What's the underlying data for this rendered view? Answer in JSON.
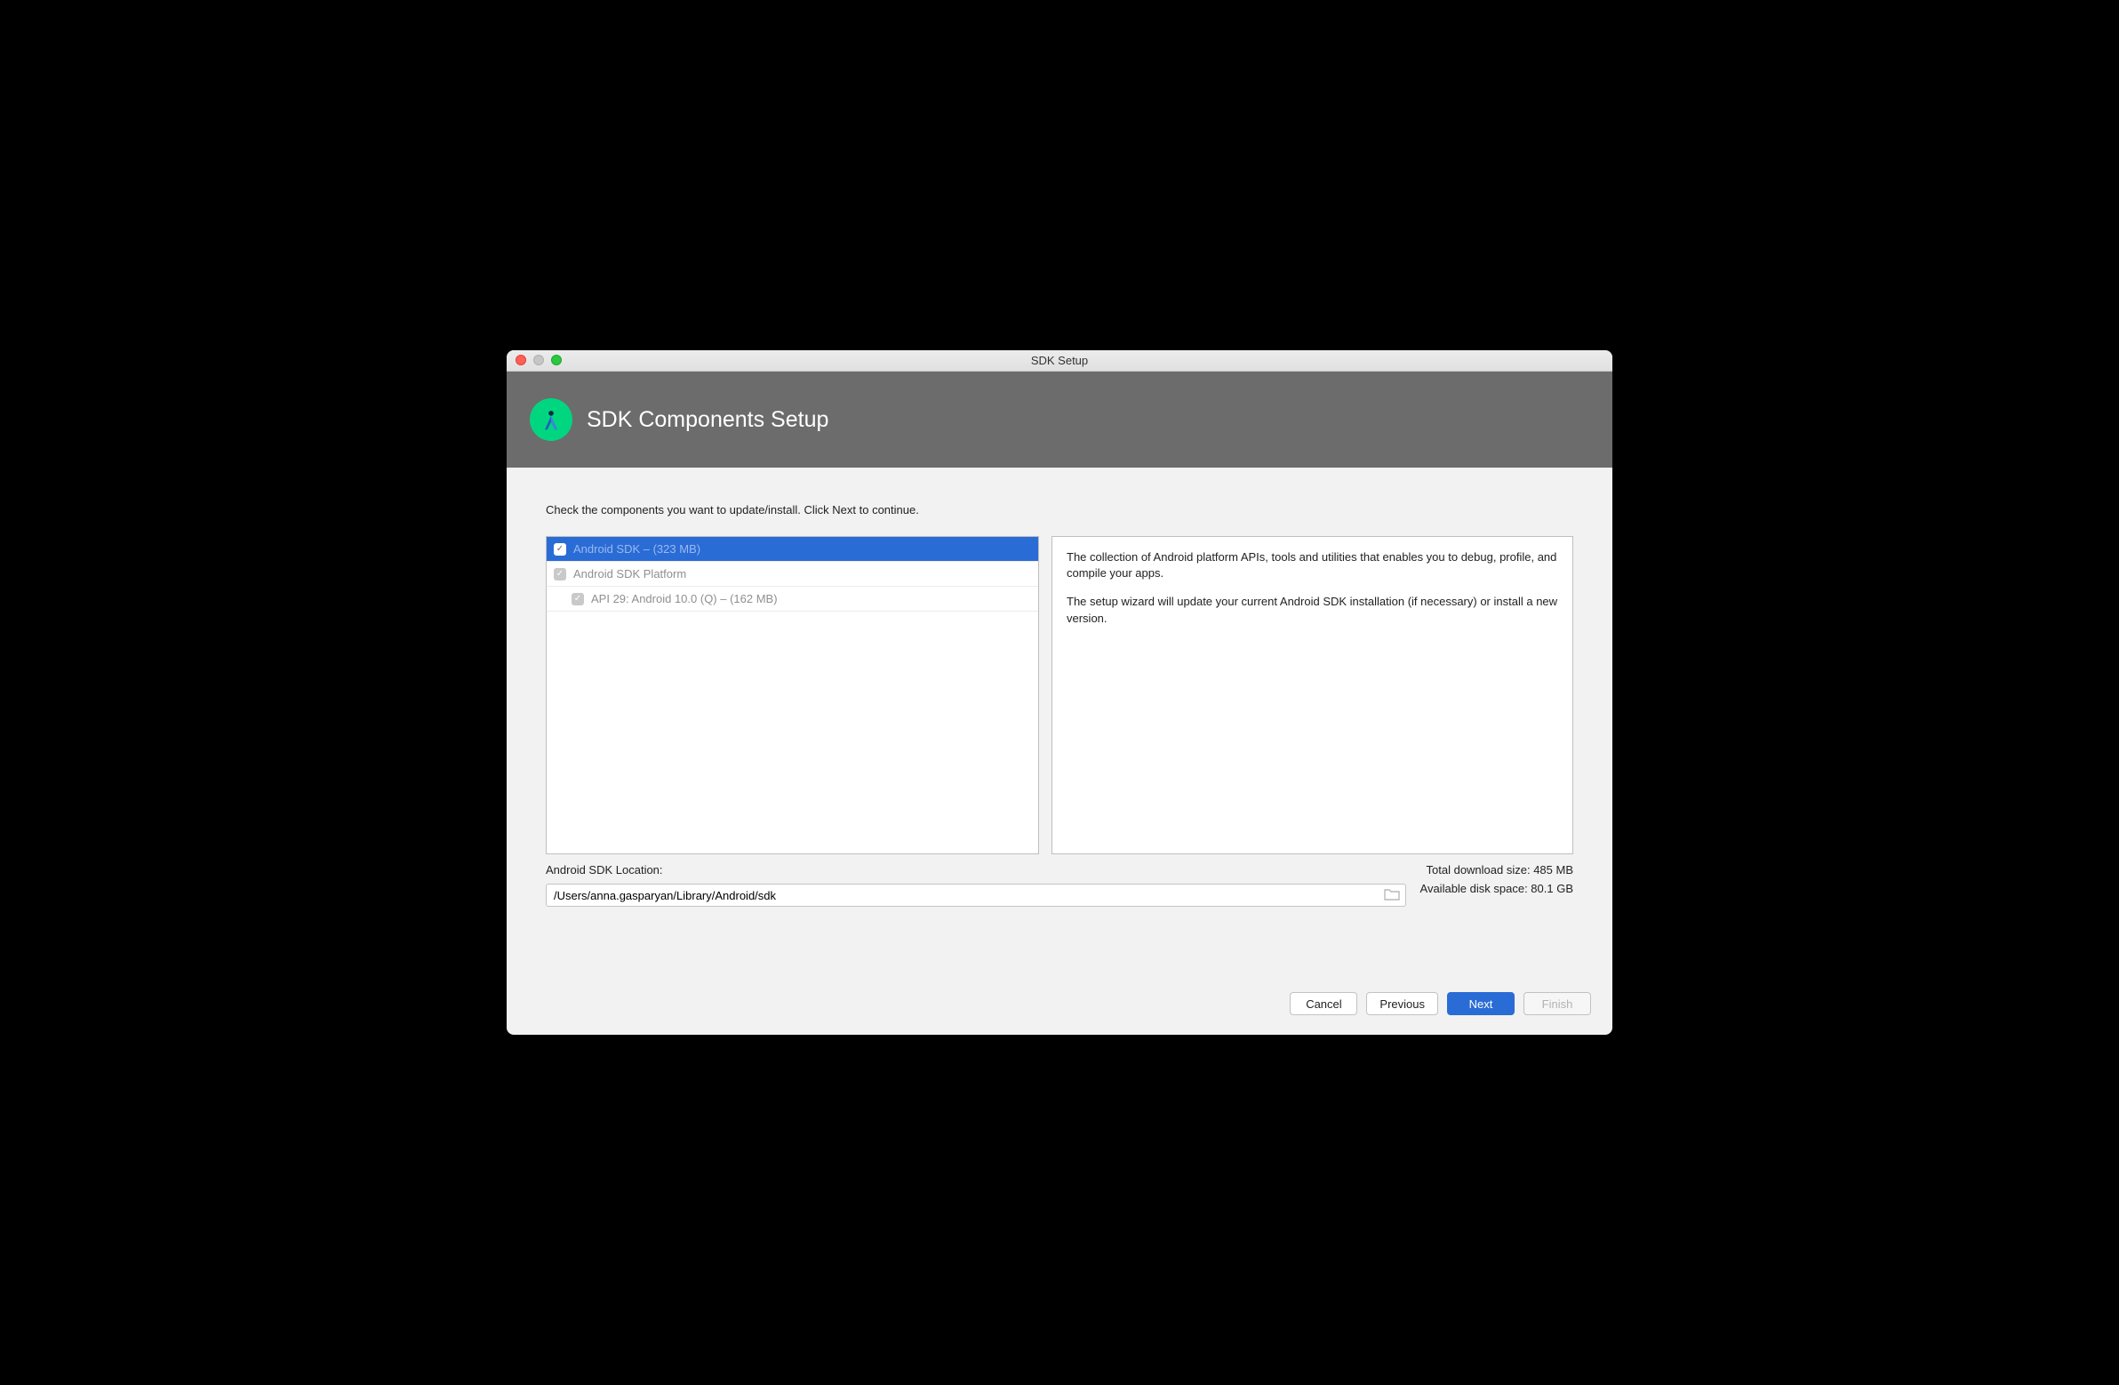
{
  "window": {
    "title": "SDK Setup"
  },
  "banner": {
    "heading": "SDK Components Setup"
  },
  "instruction": "Check the components you want to update/install. Click Next to continue.",
  "tree": {
    "items": [
      {
        "label": "Android SDK – (323 MB)",
        "selected": true,
        "enabled": true,
        "indent": 1
      },
      {
        "label": "Android SDK Platform",
        "selected": false,
        "enabled": false,
        "indent": 1
      },
      {
        "label": "API 29: Android 10.0 (Q) – (162 MB)",
        "selected": false,
        "enabled": false,
        "indent": 2
      }
    ]
  },
  "description": {
    "p1": "The collection of Android platform APIs, tools and utilities that enables you to debug, profile, and compile your apps.",
    "p2": "The setup wizard will update your current Android SDK installation (if necessary) or install a new version."
  },
  "location": {
    "label": "Android SDK Location:",
    "value": "/Users/anna.gasparyan/Library/Android/sdk"
  },
  "stats": {
    "download": "Total download size: 485 MB",
    "disk": "Available disk space: 80.1 GB"
  },
  "buttons": {
    "cancel": "Cancel",
    "previous": "Previous",
    "next": "Next",
    "finish": "Finish"
  }
}
